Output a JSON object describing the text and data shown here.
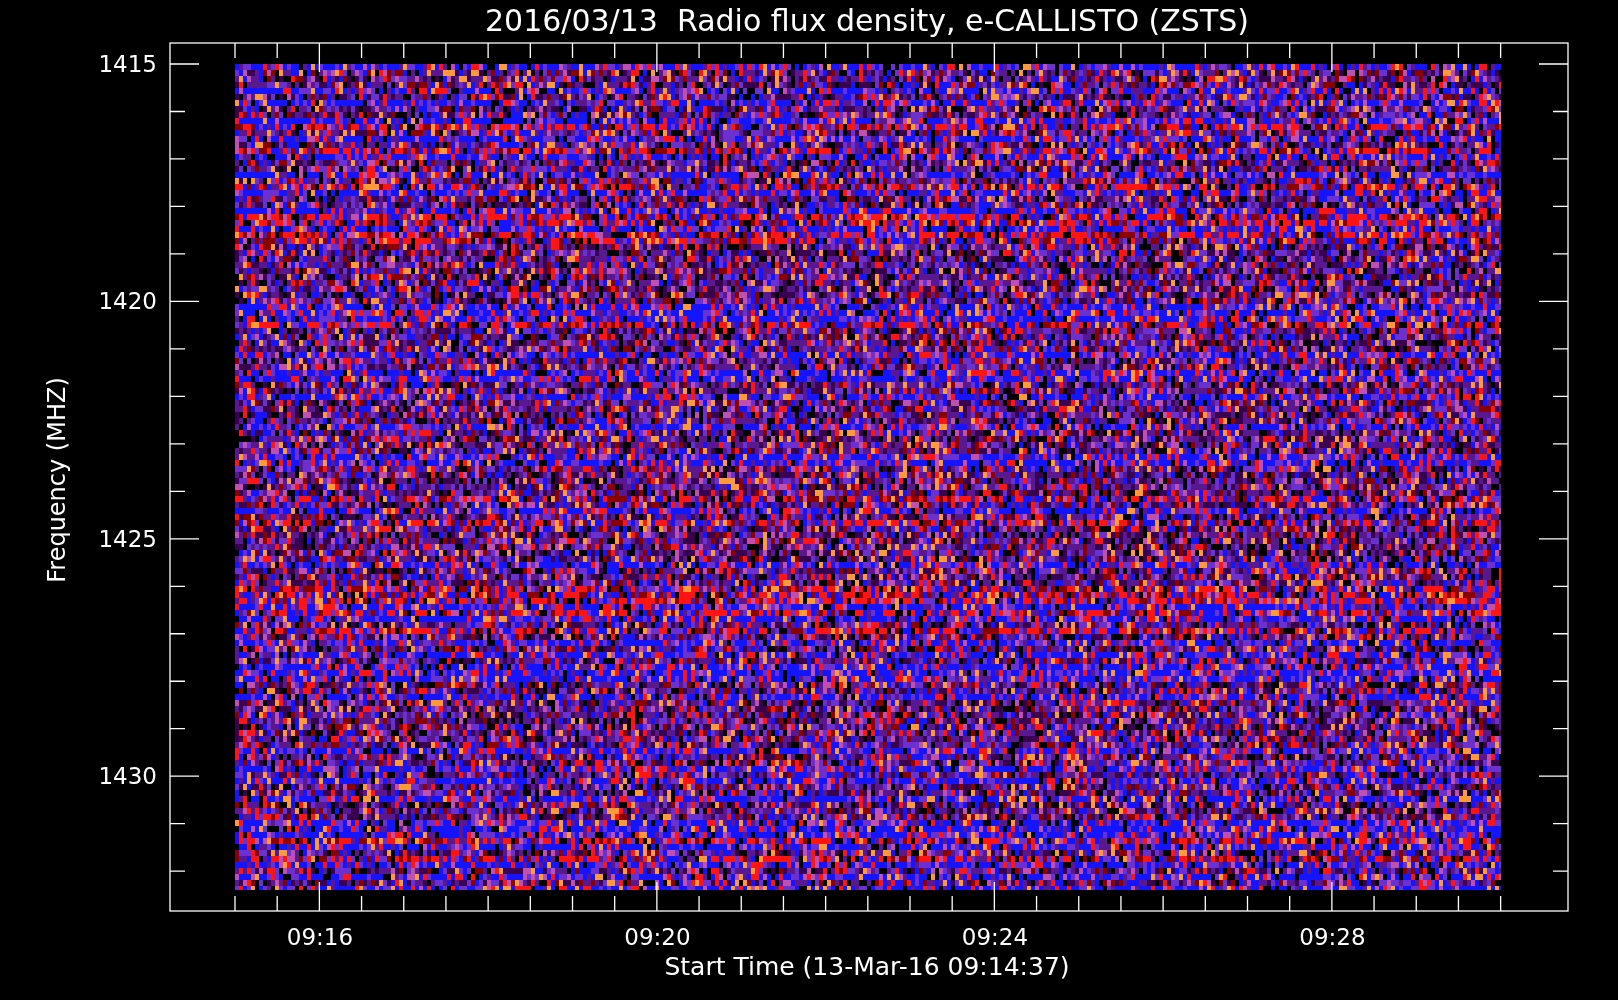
{
  "title": "2016/03/13  Radio flux density, e-CALLISTO (ZSTS)",
  "y_axis": {
    "label": "Frequency (MHZ)",
    "tick_labels": [
      "1415",
      "1420",
      "1425",
      "1430"
    ]
  },
  "x_axis": {
    "label": "Start Time (13-Mar-16 09:14:37)",
    "tick_labels": [
      "09:16",
      "09:20",
      "09:24",
      "09:28"
    ]
  }
}
